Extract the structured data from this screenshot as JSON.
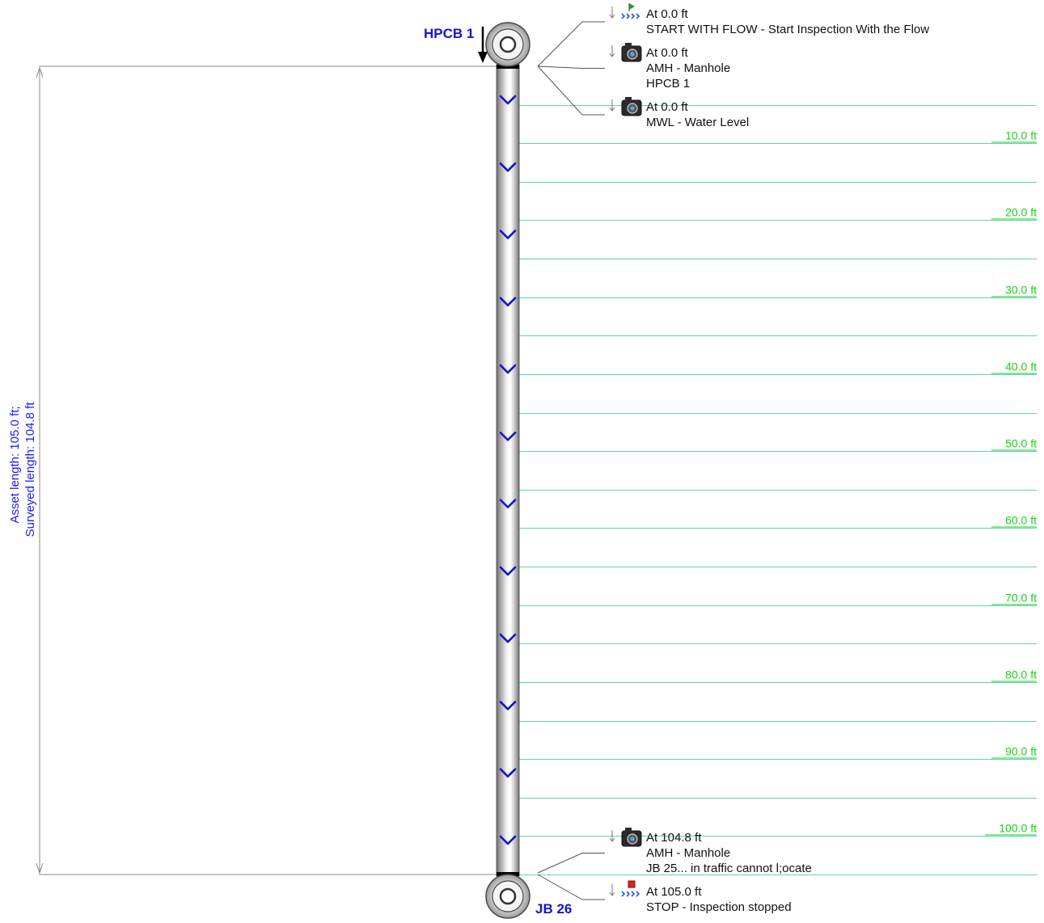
{
  "colors": {
    "dimension_line": "#888888",
    "dimension_text": "#1a1aff",
    "node_label": "#1414d2",
    "grid_line": "#5fd3b8",
    "grid_label": "#1bd11b",
    "chevron": "#1515c8",
    "leader_line": "#555555",
    "start_flag": "#1fa01f",
    "stop_marker": "#e02020",
    "flow_icon": "#2a58d8"
  },
  "dimension": {
    "line1": "Asset length: 105.0 ft;",
    "line2": "Surveyed length: 104.8 ft"
  },
  "nodes": {
    "upstream": {
      "label": "HPCB 1",
      "icon": "manhole-icon"
    },
    "downstream": {
      "label": "JB 26",
      "icon": "manhole-icon"
    }
  },
  "pipe": {
    "asset_length_ft": 105.0,
    "surveyed_length_ft": 104.8,
    "flow_direction": "down",
    "flow_chevron_count": 12
  },
  "ruler": {
    "interval_ft": 5,
    "labels": [
      "10.0 ft",
      "20.0 ft",
      "30.0 ft",
      "40.0 ft",
      "50.0 ft",
      "60.0 ft",
      "70.0 ft",
      "80.0 ft",
      "90.0 ft",
      "100.0 ft"
    ]
  },
  "observations": [
    {
      "position_ft": 0.0,
      "icon": "start-flow-icon",
      "lines": [
        "At 0.0 ft",
        "START WITH FLOW - Start Inspection With the Flow"
      ]
    },
    {
      "position_ft": 0.0,
      "icon": "camera-icon",
      "lines": [
        "At 0.0 ft",
        "AMH - Manhole",
        "HPCB 1"
      ]
    },
    {
      "position_ft": 0.0,
      "icon": "camera-icon",
      "lines": [
        "At 0.0 ft",
        "MWL - Water Level"
      ]
    },
    {
      "position_ft": 104.8,
      "icon": "camera-icon",
      "lines": [
        "At 104.8 ft",
        "AMH - Manhole",
        "JB 25... in traffic cannot l;ocate"
      ]
    },
    {
      "position_ft": 105.0,
      "icon": "stop-icon",
      "lines": [
        "At 105.0 ft",
        "STOP - Inspection stopped"
      ]
    }
  ]
}
